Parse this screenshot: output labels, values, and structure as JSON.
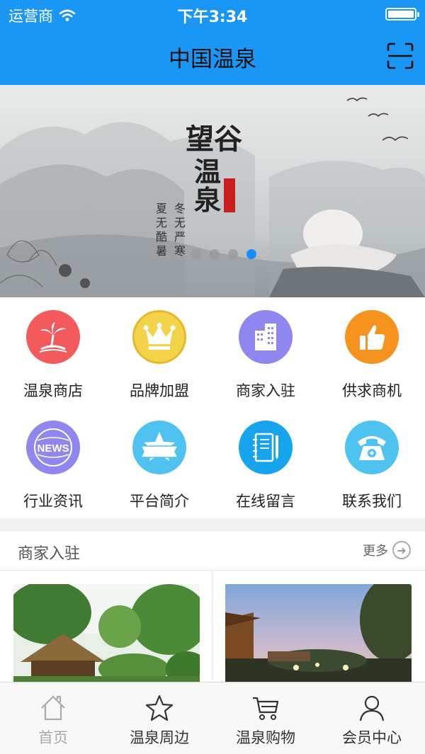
{
  "status": {
    "carrier": "运营商",
    "time": "下午3:34"
  },
  "nav": {
    "title": "中国温泉",
    "scan_icon": "scan-icon"
  },
  "banner": {
    "slides": 4,
    "active_slide": 4
  },
  "menu": [
    {
      "label": "温泉商店",
      "icon": "palm-island-icon",
      "color": "#f25a5c"
    },
    {
      "label": "品牌加盟",
      "icon": "crown-icon",
      "color": "#f3d34a"
    },
    {
      "label": "商家入驻",
      "icon": "building-icon",
      "color": "#8f86ef"
    },
    {
      "label": "供求商机",
      "icon": "thumbs-up-icon",
      "color": "#f6921e"
    },
    {
      "label": "行业资讯",
      "icon": "news-icon",
      "color": "#8f86ef"
    },
    {
      "label": "平台简介",
      "icon": "star-banner-icon",
      "color": "#4fc3f0"
    },
    {
      "label": "在线留言",
      "icon": "notebook-icon",
      "color": "#16a4ee"
    },
    {
      "label": "联系我们",
      "icon": "telephone-icon",
      "color": "#4fc3f0"
    }
  ],
  "merchants": {
    "title": "商家入驻",
    "more": "更多"
  },
  "tabs": [
    {
      "label": "首页",
      "icon": "home-icon"
    },
    {
      "label": "温泉周边",
      "icon": "star-icon"
    },
    {
      "label": "温泉购物",
      "icon": "cart-icon"
    },
    {
      "label": "会员中心",
      "icon": "person-icon"
    }
  ],
  "colors": {
    "nav": "#1a96f5",
    "active_dot": "#1a8cff"
  }
}
